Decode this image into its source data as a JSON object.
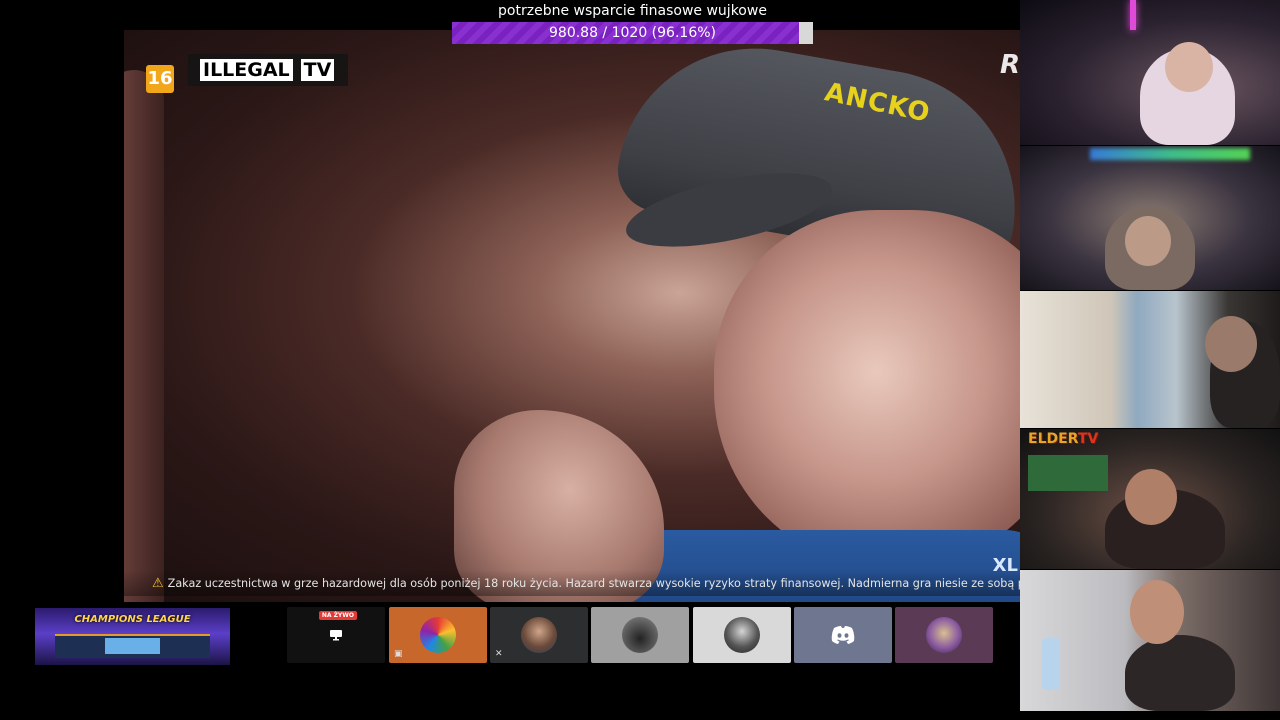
{
  "donation_goal": {
    "title": "potrzebne wsparcie finasowe wujkowe",
    "progress_text": "980.88 / 1020 (96.16%)",
    "current": 980.88,
    "target": 1020,
    "percent": 96.16,
    "fill_color": "#8a2fd0"
  },
  "main_video": {
    "age_rating": "16",
    "channel_logo": {
      "word1": "ILLEGAL",
      "word2": "TV"
    },
    "cap_text": "ANCKO",
    "corner_logo": "R",
    "corner_brand": "XL",
    "disclaimer": "Zakaz uczestnictwa w grze hazardowej dla osób poniżej 18 roku życia. Hazard stwarza wysokie ryzyko straty finansowej. Nadmierna gra niesie ze sobą potencjalne zagro",
    "warning_icon": "warning-triangle-icon"
  },
  "webcams": {
    "cam4_logo": {
      "part1": "ELDER",
      "part2": "TV"
    }
  },
  "bottom_bar": {
    "banner_title": "CHAMPIONS LEAGUE",
    "tiles": [
      {
        "icon": "screen-share-icon",
        "badge": "NA ŻYWO",
        "bg": "#111111"
      },
      {
        "icon": "avatar-rainbow",
        "bg": "#c8672c"
      },
      {
        "icon": "avatar-man-beard",
        "bg": "#2c2e2f"
      },
      {
        "icon": "avatar-car",
        "bg": "#a0a0a0"
      },
      {
        "icon": "avatar-sunglasses",
        "bg": "#d9d9d9"
      },
      {
        "icon": "discord-icon",
        "bg": "#6f7790"
      },
      {
        "icon": "avatar-purple-face",
        "bg": "#5a3a55"
      }
    ]
  }
}
